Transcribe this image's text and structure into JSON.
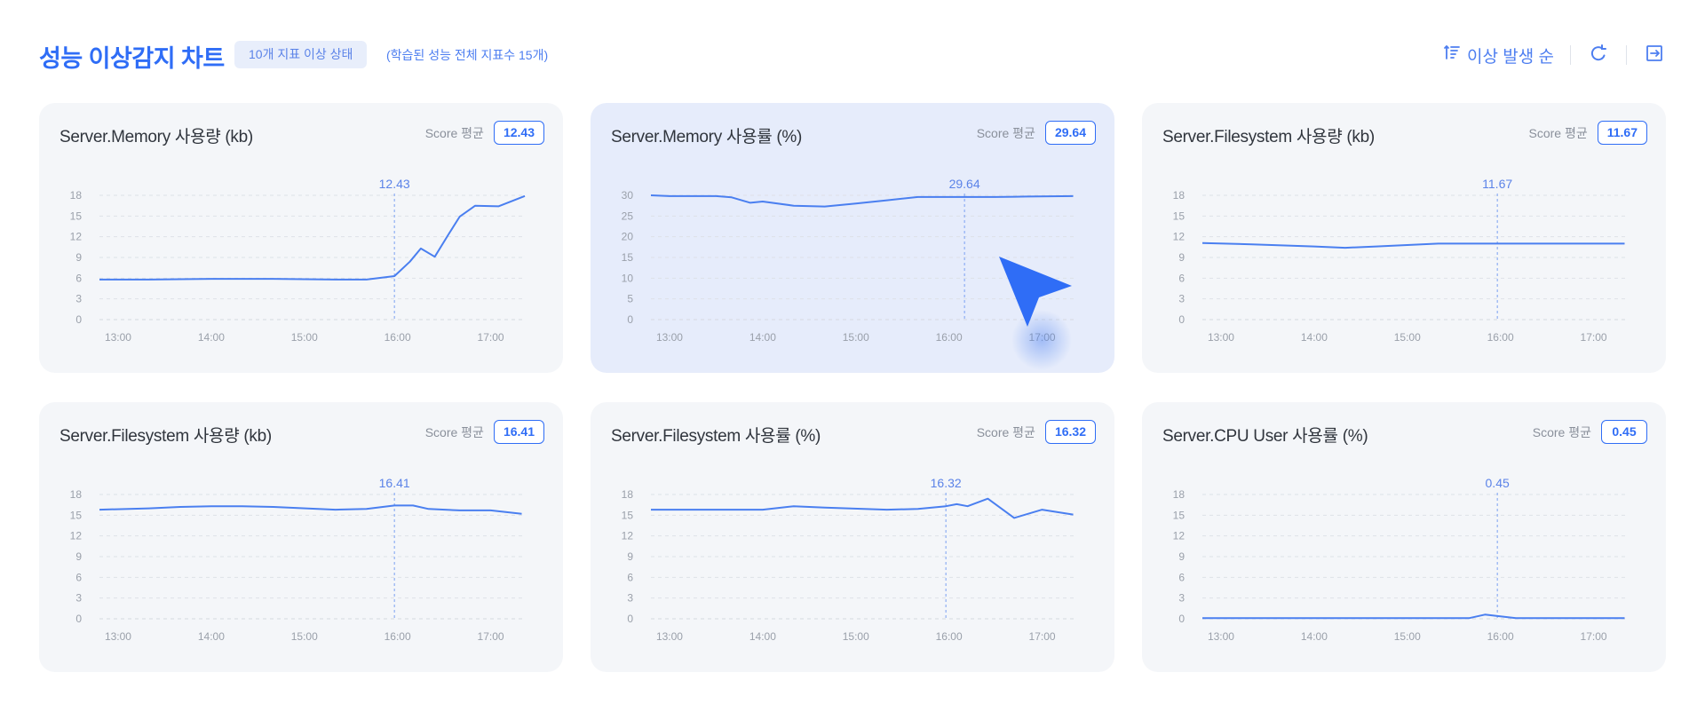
{
  "header": {
    "title": "성능 이상감지 차트",
    "badge": "10개 지표 이상 상태",
    "subtitle": "(학습된 성능 전체 지표수 15개)",
    "sort_label": "이상 발생 순"
  },
  "colors": {
    "accent": "#2f6df6",
    "card_bg": "#f4f6f9",
    "active_card_bg": "#e6ecfb",
    "line": "#4a7ff0"
  },
  "icons": {
    "sort": "sort-icon",
    "refresh": "refresh-icon",
    "exit": "exit-icon",
    "cursor": "pointer-cursor-icon"
  },
  "cards": [
    {
      "title": "Server.Memory 사용량 (kb)",
      "score_label": "Score 평균",
      "score": "12.43"
    },
    {
      "title": "Server.Memory 사용률 (%)",
      "score_label": "Score 평균",
      "score": "29.64"
    },
    {
      "title": "Server.Filesystem 사용량 (kb)",
      "score_label": "Score 평균",
      "score": "11.67"
    },
    {
      "title": "Server.Filesystem 사용량 (kb)",
      "score_label": "Score 평균",
      "score": "16.41"
    },
    {
      "title": "Server.Filesystem 사용률 (%)",
      "score_label": "Score 평균",
      "score": "16.32"
    },
    {
      "title": "Server.CPU User 사용률 (%)",
      "score_label": "Score 평균",
      "score": "0.45"
    }
  ],
  "chart_data": [
    {
      "type": "line",
      "title": "Server.Memory 사용량 (kb)",
      "x": [
        "12:48",
        "13:20",
        "14:00",
        "14:40",
        "15:20",
        "15:40",
        "15:58",
        "16:08",
        "16:15",
        "16:24",
        "16:33",
        "16:40",
        "16:50",
        "17:05",
        "17:22"
      ],
      "values": [
        5.8,
        5.8,
        5.9,
        5.9,
        5.8,
        5.8,
        6.3,
        8.4,
        10.3,
        9.1,
        12.4,
        14.9,
        16.5,
        16.4,
        17.9
      ],
      "ylim": [
        0,
        18
      ],
      "yticks": [
        0,
        3,
        6,
        9,
        12,
        15,
        18
      ],
      "xticks": [
        "13:00",
        "14:00",
        "15:00",
        "16:00",
        "17:00"
      ],
      "marker": {
        "x": "15:58",
        "label": "12.43"
      }
    },
    {
      "type": "line",
      "title": "Server.Memory 사용률 (%)",
      "x": [
        "12:48",
        "13:00",
        "13:30",
        "13:40",
        "13:52",
        "14:00",
        "14:20",
        "14:40",
        "15:00",
        "15:20",
        "15:40",
        "16:10",
        "16:30",
        "16:50",
        "17:20"
      ],
      "values": [
        30,
        29.8,
        29.8,
        29.5,
        28.2,
        28.5,
        27.5,
        27.3,
        28,
        28.8,
        29.6,
        29.6,
        29.6,
        29.7,
        29.8
      ],
      "ylim": [
        0,
        30
      ],
      "yticks": [
        0,
        5,
        10,
        15,
        20,
        25,
        30
      ],
      "xticks": [
        "13:00",
        "14:00",
        "15:00",
        "16:00",
        "17:00"
      ],
      "marker": {
        "x": "16:10",
        "label": "29.64"
      }
    },
    {
      "type": "line",
      "title": "Server.Filesystem 사용량 (kb)",
      "x": [
        "12:48",
        "13:20",
        "14:00",
        "14:20",
        "14:40",
        "15:20",
        "15:58",
        "16:20",
        "17:20"
      ],
      "values": [
        11.1,
        10.9,
        10.6,
        10.4,
        10.6,
        11.0,
        11.0,
        11.0,
        11.0
      ],
      "ylim": [
        0,
        18
      ],
      "yticks": [
        0,
        3,
        6,
        9,
        12,
        15,
        18
      ],
      "xticks": [
        "13:00",
        "14:00",
        "15:00",
        "16:00",
        "17:00"
      ],
      "marker": {
        "x": "15:58",
        "label": "11.67"
      }
    },
    {
      "type": "line",
      "title": "Server.Filesystem 사용량 (kb)",
      "x": [
        "12:48",
        "13:20",
        "13:40",
        "14:00",
        "14:20",
        "14:40",
        "15:20",
        "15:40",
        "15:58",
        "16:10",
        "16:20",
        "16:40",
        "17:00",
        "17:20"
      ],
      "values": [
        15.8,
        16,
        16.2,
        16.3,
        16.3,
        16.2,
        15.8,
        15.9,
        16.4,
        16.4,
        15.9,
        15.7,
        15.7,
        15.2
      ],
      "ylim": [
        0,
        18
      ],
      "yticks": [
        0,
        3,
        6,
        9,
        12,
        15,
        18
      ],
      "xticks": [
        "13:00",
        "14:00",
        "15:00",
        "16:00",
        "17:00"
      ],
      "marker": {
        "x": "15:58",
        "label": "16.41"
      }
    },
    {
      "type": "line",
      "title": "Server.Filesystem 사용률 (%)",
      "x": [
        "12:48",
        "13:20",
        "14:00",
        "14:20",
        "14:40",
        "15:20",
        "15:40",
        "15:58",
        "16:05",
        "16:12",
        "16:25",
        "16:42",
        "17:00",
        "17:20"
      ],
      "values": [
        15.8,
        15.8,
        15.8,
        16.3,
        16.1,
        15.8,
        15.9,
        16.3,
        16.6,
        16.3,
        17.4,
        14.6,
        15.8,
        15.1
      ],
      "ylim": [
        0,
        18
      ],
      "yticks": [
        0,
        3,
        6,
        9,
        12,
        15,
        18
      ],
      "xticks": [
        "13:00",
        "14:00",
        "15:00",
        "16:00",
        "17:00"
      ],
      "marker": {
        "x": "15:58",
        "label": "16.32"
      }
    },
    {
      "type": "line",
      "title": "Server.CPU User 사용률 (%)",
      "x": [
        "12:48",
        "13:20",
        "14:00",
        "14:40",
        "15:20",
        "15:40",
        "15:50",
        "15:58",
        "16:10",
        "16:40",
        "17:20"
      ],
      "values": [
        0.1,
        0.1,
        0.1,
        0.1,
        0.1,
        0.1,
        0.6,
        0.4,
        0.1,
        0.1,
        0.1
      ],
      "ylim": [
        0,
        18
      ],
      "yticks": [
        0,
        3,
        6,
        9,
        12,
        15,
        18
      ],
      "xticks": [
        "13:00",
        "14:00",
        "15:00",
        "16:00",
        "17:00"
      ],
      "marker": {
        "x": "15:58",
        "label": "0.45"
      }
    }
  ]
}
